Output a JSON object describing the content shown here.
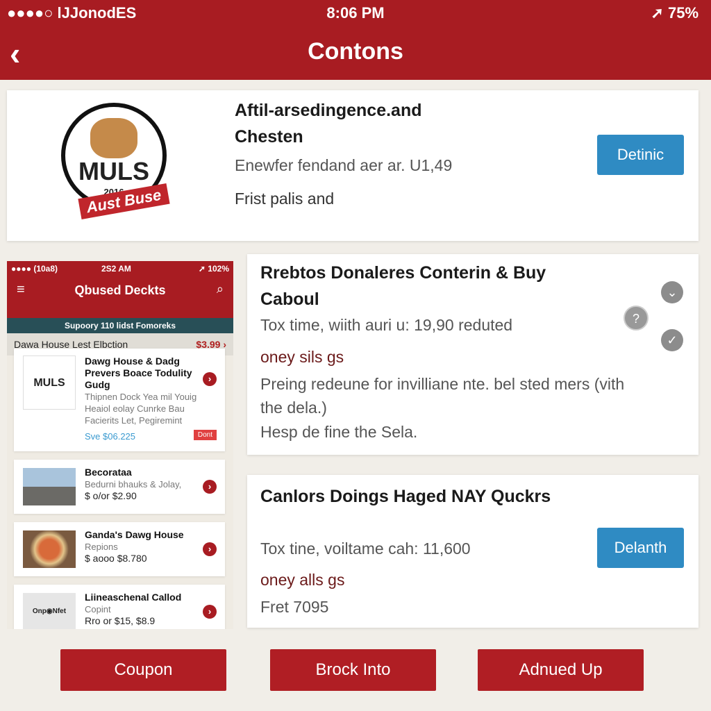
{
  "status": {
    "carrier": "●●●●○ lJJonodES",
    "time": "8:06 PM",
    "battery": "➚ 75%"
  },
  "header": {
    "back_icon": "‹",
    "title": "Contons"
  },
  "card1": {
    "logo_text": "MULS",
    "logo_year": "2016",
    "logo_ribbon": "Aust Buse",
    "title": "Aftil-arsedingence.and Chesten",
    "line1": "Enewfer fendand aer ar. U1,49",
    "line2": "Frist palis and",
    "button": "Detinic"
  },
  "mini": {
    "status_left": "●●●● (10a8)",
    "status_time": "2S2 AM",
    "status_right": "➚ 102%",
    "title": "Qbused Deckts",
    "banner": "Supoory 110 lidst Fomoreks",
    "section": "Dawa House Lest Elbction",
    "section_price": "$3.99 ›",
    "items": [
      {
        "title": "Dawg House & Dadg Prevers Boace Todulity Gudg",
        "desc": "Thipnen Dock Yea mil Youig Heaiol eolay Cunrke Bau Facierits Let, Pegiremint",
        "price": "Sve $06.225",
        "badge": "Dont",
        "logo_text": "MULS"
      },
      {
        "title": "Becorataa",
        "desc": "Bedurni bhauks & Jolay,",
        "price": "$ o/or $2.90"
      },
      {
        "title": "Ganda's Dawg House",
        "desc": "Repions",
        "price": "$ aooo $8.780"
      },
      {
        "title": "Liineaschenal Callod",
        "desc": "Copint",
        "price": "Rro or $15, $8.9",
        "img_text": "Onp◉Nfet"
      }
    ]
  },
  "card2": {
    "title": "Rrebtos Donaleres Conterin & Buy Caboul",
    "line1": "Tox time, wiith auri u: 19,90 reduted",
    "line2": "oney sils gs",
    "line3": "Preing redeune for invilliane nte. bel sted mers (vith the dela.)",
    "line4": "Hesp de fine the Sela."
  },
  "card3": {
    "title": "Canlors Doings Haged NAY Quckrs",
    "line1": "Tox tine, voiltame cah: 11,600",
    "line2": "oney alls gs",
    "line3": "Fret 7095",
    "button": "Delanth"
  },
  "buttons": [
    "Coupon",
    "Brock Into",
    "Adnued Up"
  ]
}
